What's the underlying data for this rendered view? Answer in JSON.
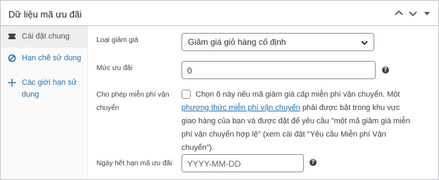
{
  "header": {
    "title": "Dữ liệu mã ưu đãi",
    "controls": [
      "chevron-up-icon",
      "chevron-down-icon",
      "caret-down-icon"
    ]
  },
  "tabs": [
    {
      "label": "Cài đặt chung",
      "icon": "ticket-icon",
      "active": true
    },
    {
      "label": "Hạn chế sử dụng",
      "icon": "block-icon",
      "active": false
    },
    {
      "label": "Các giới hạn sử dụng",
      "icon": "move-icon",
      "active": false
    }
  ],
  "fields": {
    "discount_type": {
      "label": "Loại giảm giá",
      "value": "Giảm giá giỏ hàng cố định"
    },
    "amount": {
      "label": "Mức ưu đãi",
      "value": "0"
    },
    "free_shipping": {
      "label": "Cho phép miễn phí vận chuyển",
      "checked": false,
      "text_before": "Chọn ô này nếu mã giảm giá cấp miễn phí vận chuyển. Một ",
      "link": "phương thức miễn phí vận chuyển",
      "text_after": " phải được bật trong khu vực giao hàng của bạn và được đặt để yêu cầu \"một mã giảm giá miễn phí vận chuyển hợp lệ\" (xem cài đặt \"Yêu cầu Miễn phí Vận chuyển\")."
    },
    "expiry_date": {
      "label": "Ngày hết hạn mã ưu đãi",
      "placeholder": "YYYY-MM-DD"
    }
  },
  "colors": {
    "link": "#2271b1",
    "border": "#c3c4c7",
    "sidebar_bg": "#fafafa",
    "active_tab_bg": "#eeeeee"
  }
}
